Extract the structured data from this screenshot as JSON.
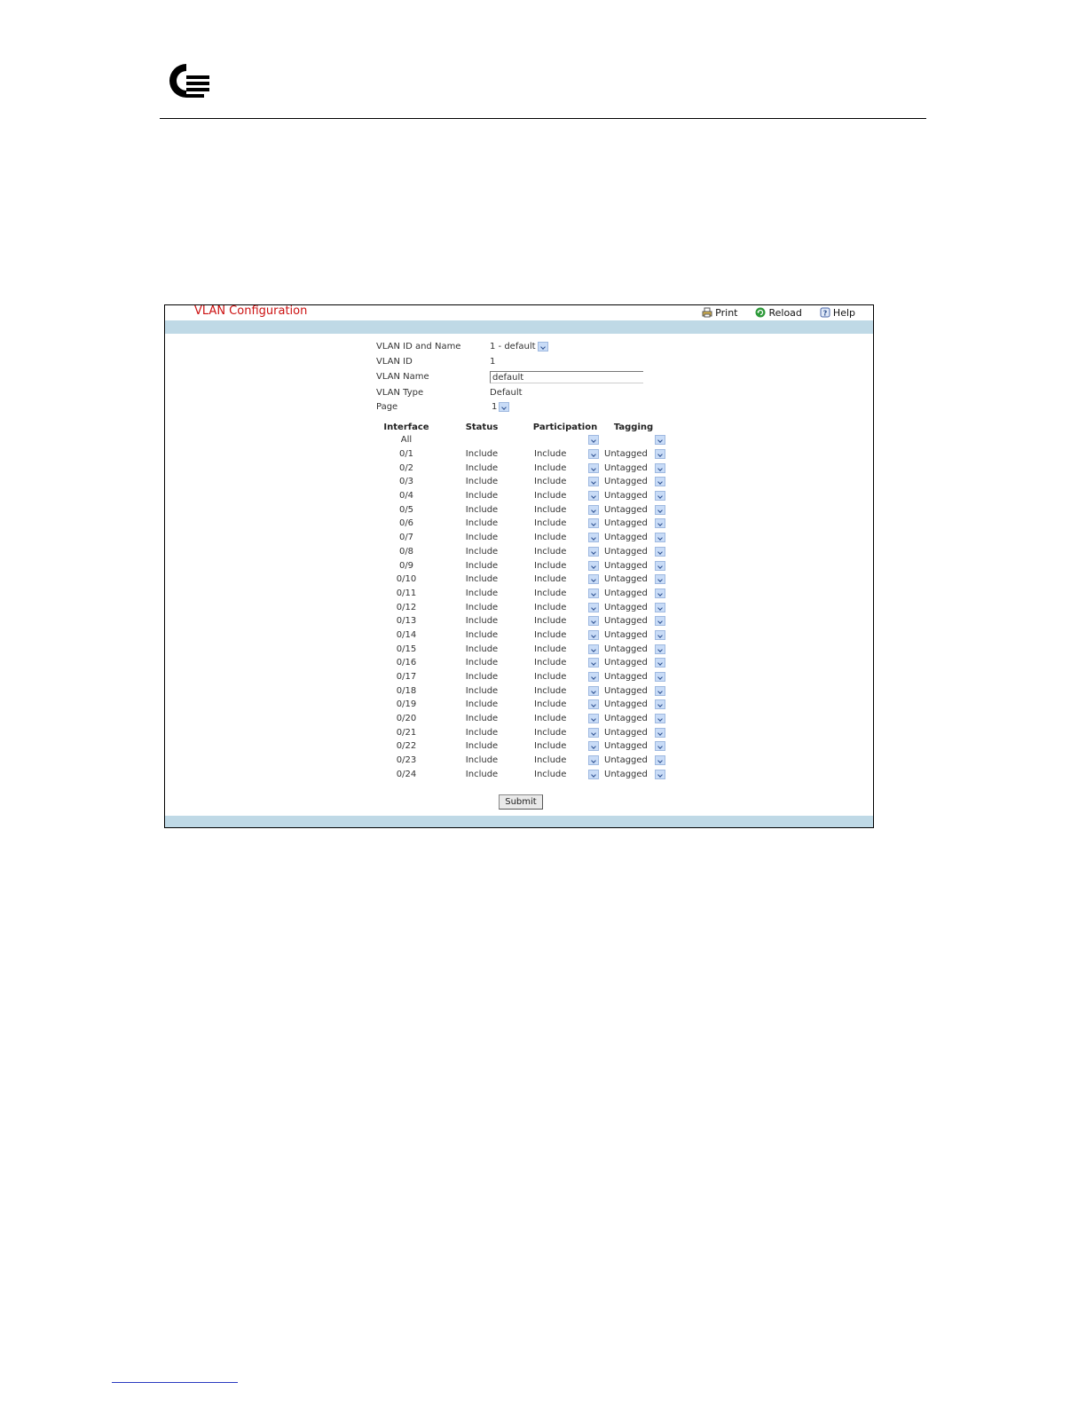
{
  "panel": {
    "title": "VLAN Configuration",
    "toolbar": {
      "print_label": "Print",
      "reload_label": "Reload",
      "help_label": "Help"
    }
  },
  "form": {
    "vlan_id_and_name_label": "VLAN ID and Name",
    "vlan_id_and_name_value": "1 - default",
    "vlan_id_label": "VLAN ID",
    "vlan_id_value": "1",
    "vlan_name_label": "VLAN Name",
    "vlan_name_value": "default",
    "vlan_type_label": "VLAN Type",
    "vlan_type_value": "Default",
    "page_label": "Page",
    "page_value": "1"
  },
  "table": {
    "headers": {
      "interface": "Interface",
      "status": "Status",
      "participation": "Participation",
      "tagging": "Tagging"
    },
    "all_row": {
      "interface": "All",
      "participation": "",
      "tagging": ""
    },
    "rows": [
      {
        "interface": "0/1",
        "status": "Include",
        "participation": "Include",
        "tagging": "Untagged"
      },
      {
        "interface": "0/2",
        "status": "Include",
        "participation": "Include",
        "tagging": "Untagged"
      },
      {
        "interface": "0/3",
        "status": "Include",
        "participation": "Include",
        "tagging": "Untagged"
      },
      {
        "interface": "0/4",
        "status": "Include",
        "participation": "Include",
        "tagging": "Untagged"
      },
      {
        "interface": "0/5",
        "status": "Include",
        "participation": "Include",
        "tagging": "Untagged"
      },
      {
        "interface": "0/6",
        "status": "Include",
        "participation": "Include",
        "tagging": "Untagged"
      },
      {
        "interface": "0/7",
        "status": "Include",
        "participation": "Include",
        "tagging": "Untagged"
      },
      {
        "interface": "0/8",
        "status": "Include",
        "participation": "Include",
        "tagging": "Untagged"
      },
      {
        "interface": "0/9",
        "status": "Include",
        "participation": "Include",
        "tagging": "Untagged"
      },
      {
        "interface": "0/10",
        "status": "Include",
        "participation": "Include",
        "tagging": "Untagged"
      },
      {
        "interface": "0/11",
        "status": "Include",
        "participation": "Include",
        "tagging": "Untagged"
      },
      {
        "interface": "0/12",
        "status": "Include",
        "participation": "Include",
        "tagging": "Untagged"
      },
      {
        "interface": "0/13",
        "status": "Include",
        "participation": "Include",
        "tagging": "Untagged"
      },
      {
        "interface": "0/14",
        "status": "Include",
        "participation": "Include",
        "tagging": "Untagged"
      },
      {
        "interface": "0/15",
        "status": "Include",
        "participation": "Include",
        "tagging": "Untagged"
      },
      {
        "interface": "0/16",
        "status": "Include",
        "participation": "Include",
        "tagging": "Untagged"
      },
      {
        "interface": "0/17",
        "status": "Include",
        "participation": "Include",
        "tagging": "Untagged"
      },
      {
        "interface": "0/18",
        "status": "Include",
        "participation": "Include",
        "tagging": "Untagged"
      },
      {
        "interface": "0/19",
        "status": "Include",
        "participation": "Include",
        "tagging": "Untagged"
      },
      {
        "interface": "0/20",
        "status": "Include",
        "participation": "Include",
        "tagging": "Untagged"
      },
      {
        "interface": "0/21",
        "status": "Include",
        "participation": "Include",
        "tagging": "Untagged"
      },
      {
        "interface": "0/22",
        "status": "Include",
        "participation": "Include",
        "tagging": "Untagged"
      },
      {
        "interface": "0/23",
        "status": "Include",
        "participation": "Include",
        "tagging": "Untagged"
      },
      {
        "interface": "0/24",
        "status": "Include",
        "participation": "Include",
        "tagging": "Untagged"
      }
    ]
  },
  "submit_label": "Submit",
  "colors": {
    "title_red": "#cc1111",
    "bar_blue": "#bfd9e6",
    "select_arrow": "#c9dcf7"
  },
  "icons": {
    "logo": "company-logo",
    "print": "printer-icon",
    "reload": "reload-icon",
    "help": "help-icon",
    "dropdown": "chevron-down-icon"
  }
}
